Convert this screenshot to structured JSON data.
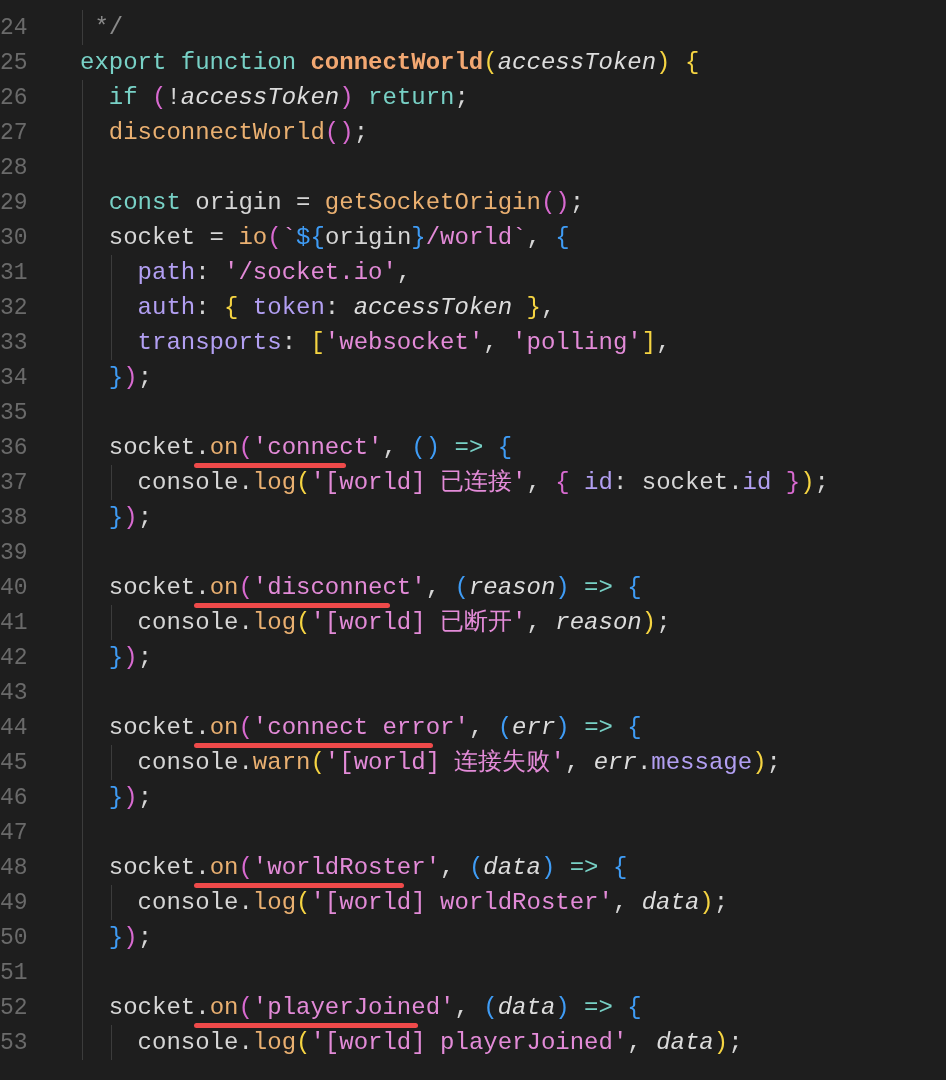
{
  "editor": {
    "lines": [
      {
        "number": "24",
        "tokens": [
          {
            "t": " */",
            "kind": "cm"
          }
        ]
      },
      {
        "number": "25",
        "tokens": [
          {
            "t": "export function ",
            "kind": "kw"
          },
          {
            "t": "connectWorld",
            "kind": "fn"
          },
          {
            "t": "(",
            "kind": "b1"
          },
          {
            "t": "accessToken",
            "kind": "param"
          },
          {
            "t": ") {",
            "kind": "b1"
          }
        ]
      },
      {
        "number": "26",
        "tokens": [
          {
            "t": "  if ",
            "kind": "kw"
          },
          {
            "t": "(",
            "kind": "b2"
          },
          {
            "t": "!",
            "kind": "plain"
          },
          {
            "t": "accessToken",
            "kind": "param"
          },
          {
            "t": ")",
            "kind": "b2"
          },
          {
            "t": " return",
            "kind": "kw"
          },
          {
            "t": ";",
            "kind": "plain"
          }
        ]
      },
      {
        "number": "27",
        "tokens": [
          {
            "t": "  disconnectWorld",
            "kind": "call"
          },
          {
            "t": "()",
            "kind": "b2"
          },
          {
            "t": ";",
            "kind": "plain"
          }
        ]
      },
      {
        "number": "28"
      },
      {
        "number": "29",
        "tokens": [
          {
            "t": "  const",
            "kind": "kw"
          },
          {
            "t": " origin = ",
            "kind": "plain"
          },
          {
            "t": "getSocketOrigin",
            "kind": "call"
          },
          {
            "t": "()",
            "kind": "b2"
          },
          {
            "t": ";",
            "kind": "plain"
          }
        ]
      },
      {
        "number": "30",
        "tokens": [
          {
            "t": "  socket = ",
            "kind": "plain"
          },
          {
            "t": "io",
            "kind": "call"
          },
          {
            "t": "(",
            "kind": "b2"
          },
          {
            "t": "`",
            "kind": "str"
          },
          {
            "t": "${",
            "kind": "b3"
          },
          {
            "t": "origin",
            "kind": "plain"
          },
          {
            "t": "}",
            "kind": "b3"
          },
          {
            "t": "/world`",
            "kind": "str"
          },
          {
            "t": ", ",
            "kind": "plain"
          },
          {
            "t": "{",
            "kind": "b3"
          }
        ]
      },
      {
        "number": "31",
        "tokens": [
          {
            "t": "    path",
            "kind": "prop"
          },
          {
            "t": ": ",
            "kind": "plain"
          },
          {
            "t": "'/socket.io'",
            "kind": "str"
          },
          {
            "t": ",",
            "kind": "plain"
          }
        ]
      },
      {
        "number": "32",
        "tokens": [
          {
            "t": "    auth",
            "kind": "prop"
          },
          {
            "t": ": ",
            "kind": "plain"
          },
          {
            "t": "{ ",
            "kind": "b1"
          },
          {
            "t": "token",
            "kind": "prop"
          },
          {
            "t": ": ",
            "kind": "plain"
          },
          {
            "t": "accessToken",
            "kind": "param"
          },
          {
            "t": " }",
            "kind": "b1"
          },
          {
            "t": ",",
            "kind": "plain"
          }
        ]
      },
      {
        "number": "33",
        "tokens": [
          {
            "t": "    transports",
            "kind": "prop"
          },
          {
            "t": ": ",
            "kind": "plain"
          },
          {
            "t": "[",
            "kind": "b1"
          },
          {
            "t": "'websocket'",
            "kind": "str"
          },
          {
            "t": ", ",
            "kind": "plain"
          },
          {
            "t": "'polling'",
            "kind": "str"
          },
          {
            "t": "]",
            "kind": "b1"
          },
          {
            "t": ",",
            "kind": "plain"
          }
        ]
      },
      {
        "number": "34",
        "tokens": [
          {
            "t": "  }",
            "kind": "b3"
          },
          {
            "t": ")",
            "kind": "b2"
          },
          {
            "t": ";",
            "kind": "plain"
          }
        ]
      },
      {
        "number": "35"
      },
      {
        "number": "36",
        "tokens": [
          {
            "t": "  socket.",
            "kind": "plain"
          }
        ],
        "underlined": [
          {
            "t": "on",
            "kind": "call"
          },
          {
            "t": "(",
            "kind": "b2"
          },
          {
            "t": "'connect'",
            "kind": "str"
          }
        ],
        "after": [
          {
            "t": ", ",
            "kind": "plain"
          },
          {
            "t": "()",
            "kind": "b3"
          },
          {
            "t": " => ",
            "kind": "kw"
          },
          {
            "t": "{",
            "kind": "b3"
          }
        ]
      },
      {
        "number": "37",
        "tokens": [
          {
            "t": "    console.",
            "kind": "plain"
          },
          {
            "t": "log",
            "kind": "call"
          },
          {
            "t": "(",
            "kind": "b1"
          },
          {
            "t": "'[world] 已连接'",
            "kind": "str"
          },
          {
            "t": ", ",
            "kind": "plain"
          },
          {
            "t": "{ ",
            "kind": "b2"
          },
          {
            "t": "id",
            "kind": "prop"
          },
          {
            "t": ": socket.",
            "kind": "plain"
          },
          {
            "t": "id",
            "kind": "prop"
          },
          {
            "t": " }",
            "kind": "b2"
          },
          {
            "t": ")",
            "kind": "b1"
          },
          {
            "t": ";",
            "kind": "plain"
          }
        ]
      },
      {
        "number": "38",
        "tokens": [
          {
            "t": "  }",
            "kind": "b3"
          },
          {
            "t": ")",
            "kind": "b2"
          },
          {
            "t": ";",
            "kind": "plain"
          }
        ]
      },
      {
        "number": "39"
      },
      {
        "number": "40",
        "tokens": [
          {
            "t": "  socket.",
            "kind": "plain"
          }
        ],
        "underlined": [
          {
            "t": "on",
            "kind": "call"
          },
          {
            "t": "(",
            "kind": "b2"
          },
          {
            "t": "'disconnect'",
            "kind": "str"
          }
        ],
        "after": [
          {
            "t": ", ",
            "kind": "plain"
          },
          {
            "t": "(",
            "kind": "b3"
          },
          {
            "t": "reason",
            "kind": "param"
          },
          {
            "t": ")",
            "kind": "b3"
          },
          {
            "t": " => ",
            "kind": "kw"
          },
          {
            "t": "{",
            "kind": "b3"
          }
        ]
      },
      {
        "number": "41",
        "tokens": [
          {
            "t": "    console.",
            "kind": "plain"
          },
          {
            "t": "log",
            "kind": "call"
          },
          {
            "t": "(",
            "kind": "b1"
          },
          {
            "t": "'[world] 已断开'",
            "kind": "str"
          },
          {
            "t": ", ",
            "kind": "plain"
          },
          {
            "t": "reason",
            "kind": "param"
          },
          {
            "t": ")",
            "kind": "b1"
          },
          {
            "t": ";",
            "kind": "plain"
          }
        ]
      },
      {
        "number": "42",
        "tokens": [
          {
            "t": "  }",
            "kind": "b3"
          },
          {
            "t": ")",
            "kind": "b2"
          },
          {
            "t": ";",
            "kind": "plain"
          }
        ]
      },
      {
        "number": "43"
      },
      {
        "number": "44",
        "tokens": [
          {
            "t": "  socket.",
            "kind": "plain"
          }
        ],
        "underlined": [
          {
            "t": "on",
            "kind": "call"
          },
          {
            "t": "(",
            "kind": "b2"
          },
          {
            "t": "'connect error'",
            "kind": "str"
          }
        ],
        "after": [
          {
            "t": ", ",
            "kind": "plain"
          },
          {
            "t": "(",
            "kind": "b3"
          },
          {
            "t": "err",
            "kind": "param"
          },
          {
            "t": ")",
            "kind": "b3"
          },
          {
            "t": " => ",
            "kind": "kw"
          },
          {
            "t": "{",
            "kind": "b3"
          }
        ]
      },
      {
        "number": "45",
        "tokens": [
          {
            "t": "    console.",
            "kind": "plain"
          },
          {
            "t": "warn",
            "kind": "call"
          },
          {
            "t": "(",
            "kind": "b1"
          },
          {
            "t": "'[world] 连接失败'",
            "kind": "str"
          },
          {
            "t": ", ",
            "kind": "plain"
          },
          {
            "t": "err",
            "kind": "param"
          },
          {
            "t": ".",
            "kind": "plain"
          },
          {
            "t": "message",
            "kind": "prop"
          },
          {
            "t": ")",
            "kind": "b1"
          },
          {
            "t": ";",
            "kind": "plain"
          }
        ]
      },
      {
        "number": "46",
        "tokens": [
          {
            "t": "  }",
            "kind": "b3"
          },
          {
            "t": ")",
            "kind": "b2"
          },
          {
            "t": ";",
            "kind": "plain"
          }
        ]
      },
      {
        "number": "47"
      },
      {
        "number": "48",
        "tokens": [
          {
            "t": "  socket.",
            "kind": "plain"
          }
        ],
        "underlined": [
          {
            "t": "on",
            "kind": "call"
          },
          {
            "t": "(",
            "kind": "b2"
          },
          {
            "t": "'worldRoster'",
            "kind": "str"
          }
        ],
        "after": [
          {
            "t": ", ",
            "kind": "plain"
          },
          {
            "t": "(",
            "kind": "b3"
          },
          {
            "t": "data",
            "kind": "param"
          },
          {
            "t": ")",
            "kind": "b3"
          },
          {
            "t": " => ",
            "kind": "kw"
          },
          {
            "t": "{",
            "kind": "b3"
          }
        ]
      },
      {
        "number": "49",
        "tokens": [
          {
            "t": "    console.",
            "kind": "plain"
          },
          {
            "t": "log",
            "kind": "call"
          },
          {
            "t": "(",
            "kind": "b1"
          },
          {
            "t": "'[world] worldRoster'",
            "kind": "str"
          },
          {
            "t": ", ",
            "kind": "plain"
          },
          {
            "t": "data",
            "kind": "param"
          },
          {
            "t": ")",
            "kind": "b1"
          },
          {
            "t": ";",
            "kind": "plain"
          }
        ]
      },
      {
        "number": "50",
        "tokens": [
          {
            "t": "  }",
            "kind": "b3"
          },
          {
            "t": ")",
            "kind": "b2"
          },
          {
            "t": ";",
            "kind": "plain"
          }
        ]
      },
      {
        "number": "51"
      },
      {
        "number": "52",
        "tokens": [
          {
            "t": "  socket.",
            "kind": "plain"
          }
        ],
        "underlined": [
          {
            "t": "on",
            "kind": "call"
          },
          {
            "t": "(",
            "kind": "b2"
          },
          {
            "t": "'playerJoined'",
            "kind": "str"
          }
        ],
        "after": [
          {
            "t": ", ",
            "kind": "plain"
          },
          {
            "t": "(",
            "kind": "b3"
          },
          {
            "t": "data",
            "kind": "param"
          },
          {
            "t": ")",
            "kind": "b3"
          },
          {
            "t": " => ",
            "kind": "kw"
          },
          {
            "t": "{",
            "kind": "b3"
          }
        ]
      },
      {
        "number": "53",
        "tokens": [
          {
            "t": "    console.",
            "kind": "plain"
          },
          {
            "t": "log",
            "kind": "call"
          },
          {
            "t": "(",
            "kind": "b1"
          },
          {
            "t": "'[world] playerJoined'",
            "kind": "str"
          },
          {
            "t": ", ",
            "kind": "plain"
          },
          {
            "t": "data",
            "kind": "param"
          },
          {
            "t": ")",
            "kind": "b1"
          },
          {
            "t": ";",
            "kind": "plain"
          }
        ]
      }
    ]
  }
}
